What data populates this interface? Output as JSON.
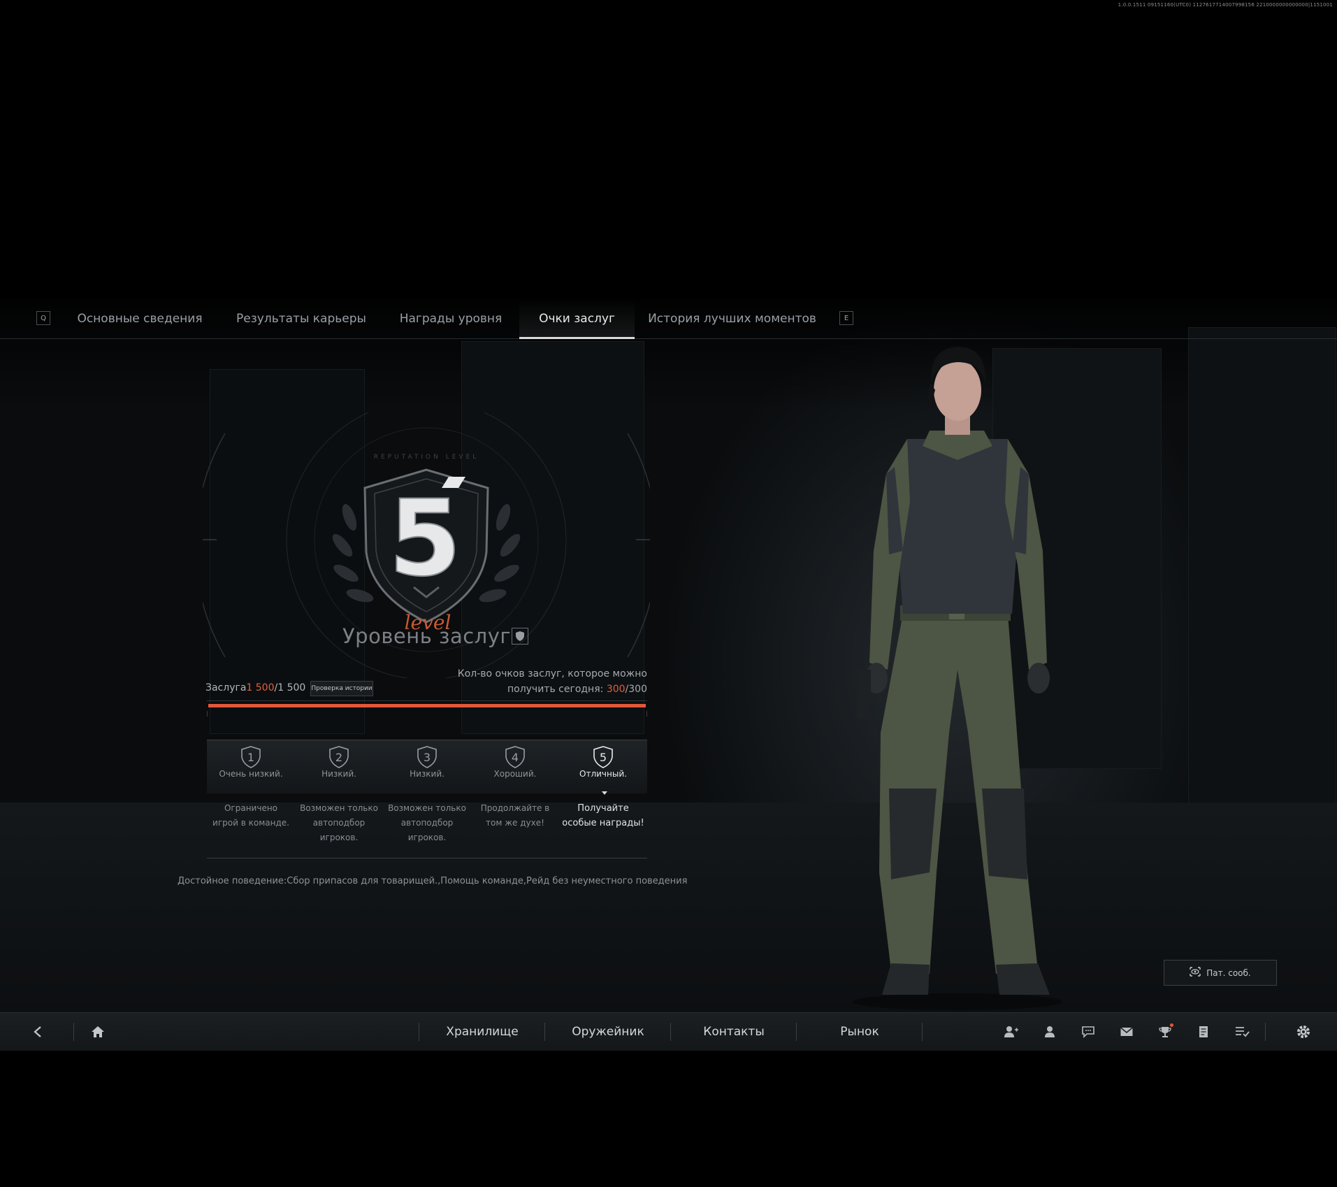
{
  "build_info": "1.0.0.1511 09151160(UTC0) 1127617714007998156 2210000000000000|1151001",
  "tabs": {
    "prev_key": "Q",
    "next_key": "E",
    "items": [
      {
        "label": "Основные сведения"
      },
      {
        "label": "Результаты карьеры"
      },
      {
        "label": "Награды уровня"
      },
      {
        "label": "Очки заслуг"
      },
      {
        "label": "История лучших моментов"
      }
    ],
    "active_index": 3
  },
  "emblem": {
    "level_number": "5",
    "ring_text": "REPUTATION LEVEL",
    "script_text": "level",
    "title": "Уровень заслуг"
  },
  "merit": {
    "label": "Заслуга",
    "current": "1 500",
    "separator": "/",
    "max": "1 500",
    "history_button": "Проверка истории",
    "today_line1": "Кол-во очков заслуг, которое можно",
    "today_line2_prefix": "получить сегодня: ",
    "today_current": "300",
    "today_separator": "/",
    "today_max": "300",
    "progress_fraction": 1.0,
    "accent_color": "#e2573a"
  },
  "levels": [
    {
      "number": "1",
      "name": "Очень низкий.",
      "desc": [
        "Ограничено",
        "игрой в команде."
      ]
    },
    {
      "number": "2",
      "name": "Низкий.",
      "desc": [
        "Возможен только",
        "автоподбор",
        "игроков."
      ]
    },
    {
      "number": "3",
      "name": "Низкий.",
      "desc": [
        "Возможен только",
        "автоподбор",
        "игроков."
      ]
    },
    {
      "number": "4",
      "name": "Хороший.",
      "desc": [
        "Продолжайте в",
        "том же духе!"
      ]
    },
    {
      "number": "5",
      "name": "Отличный.",
      "desc": [
        "Получайте",
        "особые награды!"
      ]
    }
  ],
  "current_level_index": 4,
  "behavior_text": "Достойное поведение:Сбор припасов для товарищей.,Помощь команде,Рейд без неуместного поведения",
  "patrol_button": {
    "label": "Пат. сооб.",
    "icon": "eye-scan-icon"
  },
  "bottom_nav": {
    "back_icon": "back-arrow-icon",
    "home_icon": "home-icon",
    "items": [
      {
        "label": "Хранилище"
      },
      {
        "label": "Оружейник"
      },
      {
        "label": "Контакты"
      },
      {
        "label": "Рынок"
      }
    ],
    "right_icons": [
      "team-icon",
      "profile-icon",
      "chat-icon",
      "mail-icon",
      "trophy-icon",
      "notes-icon",
      "tasks-icon",
      "settings-icon"
    ]
  }
}
